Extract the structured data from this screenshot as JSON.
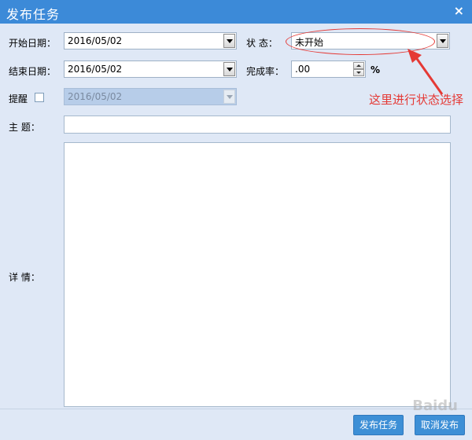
{
  "window": {
    "title": "发布任务",
    "close": "×"
  },
  "form": {
    "start_date_label": "开始日期：",
    "start_date_value": "2016/05/02",
    "status_label": "状  态：",
    "status_value": "未开始",
    "end_date_label": "结束日期：",
    "end_date_value": "2016/05/02",
    "completion_label": "完成率：",
    "completion_value": ".00",
    "completion_unit": "%",
    "remind_label": "提醒",
    "remind_date_value": "2016/05/02",
    "subject_label": "主    题：",
    "subject_value": "",
    "details_label": "详    情：",
    "details_value": ""
  },
  "annotation": {
    "text": "这里进行状态选择",
    "color": "#e53935"
  },
  "buttons": {
    "publish": "发布任务",
    "cancel": "取消发布"
  },
  "colors": {
    "titlebar": "#3c8ad8",
    "background": "#dfe8f6",
    "button": "#3d8fd6"
  }
}
